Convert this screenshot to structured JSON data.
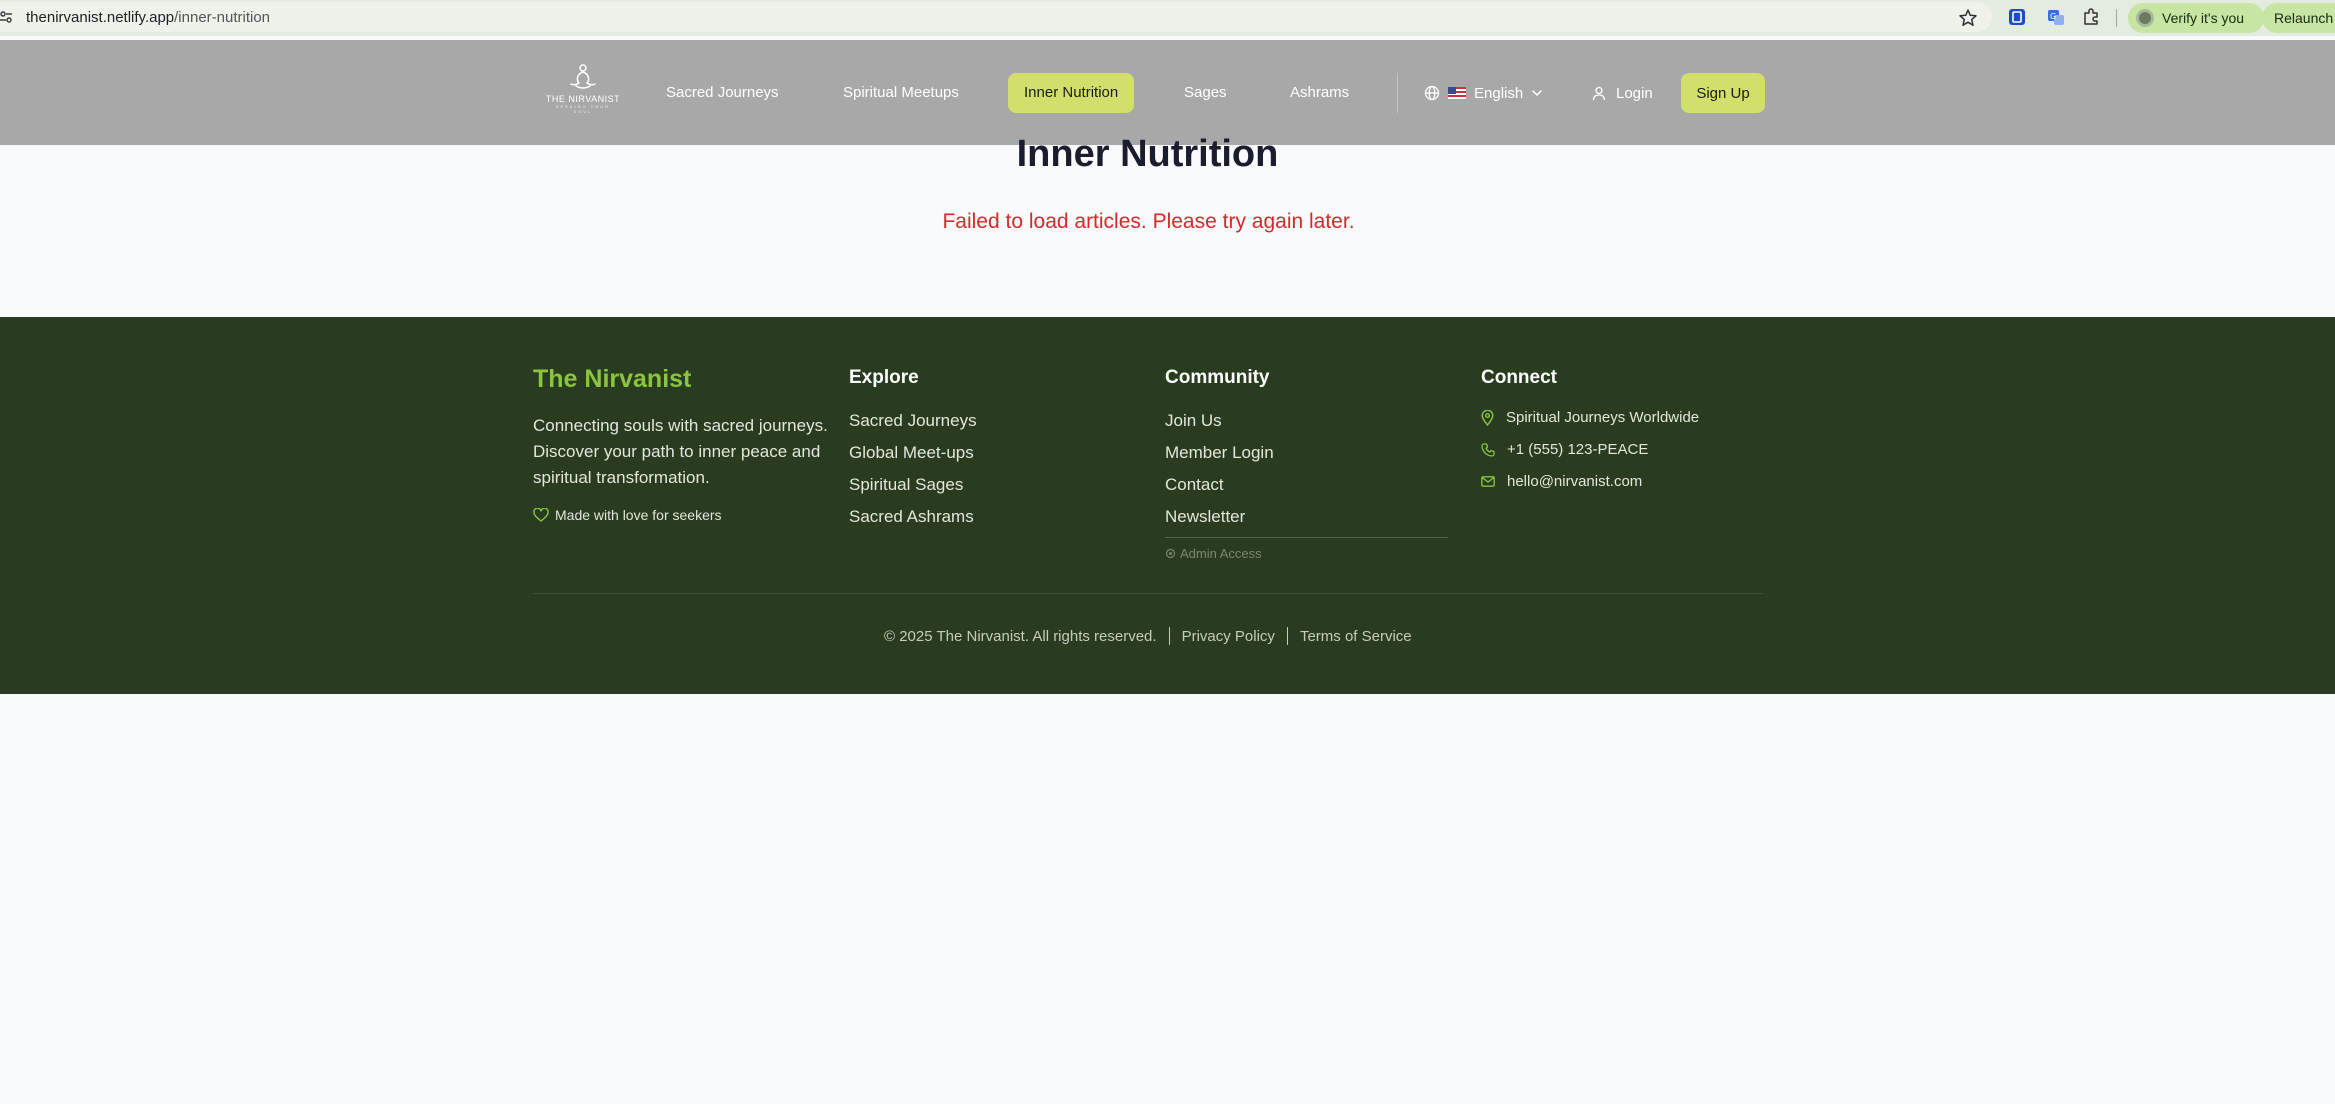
{
  "browser": {
    "url_host": "thenirvanist.netlify.app",
    "url_path": "/inner-nutrition",
    "verify_label": "Verify it's you",
    "relaunch_label": "Relaunch"
  },
  "header": {
    "logo_text": "THE NIRVANIST",
    "logo_tagline": "SEEKING YOUR SOUL",
    "nav": [
      {
        "label": "Sacred Journeys"
      },
      {
        "label": "Spiritual Meetups"
      },
      {
        "label": "Inner Nutrition"
      },
      {
        "label": "Sages"
      },
      {
        "label": "Ashrams"
      }
    ],
    "active_nav": "Inner Nutrition",
    "language": "English",
    "login_label": "Login",
    "signup_label": "Sign Up"
  },
  "main": {
    "title": "Inner Nutrition",
    "error": "Failed to load articles. Please try again later."
  },
  "footer": {
    "brand": "The Nirvanist",
    "description": "Connecting souls with sacred journeys. Discover your path to inner peace and spiritual transformation.",
    "made_with": "Made with love for seekers",
    "explore": {
      "title": "Explore",
      "links": [
        "Sacred Journeys",
        "Global Meet-ups",
        "Spiritual Sages",
        "Sacred Ashrams"
      ]
    },
    "community": {
      "title": "Community",
      "links": [
        "Join Us",
        "Member Login",
        "Contact",
        "Newsletter"
      ],
      "admin": "Admin Access"
    },
    "connect": {
      "title": "Connect",
      "location": "Spiritual Journeys Worldwide",
      "phone": "+1 (555) 123-PEACE",
      "email": "hello@nirvanist.com"
    },
    "copyright": "© 2025 The Nirvanist. All rights reserved.",
    "privacy": "Privacy Policy",
    "terms": "Terms of Service"
  },
  "colors": {
    "accent": "#d2df6b",
    "footer_bg": "#2a3c20",
    "brand_green": "#8ac540",
    "error_red": "#d42a2a",
    "header_bg": "#a8a8a8"
  }
}
